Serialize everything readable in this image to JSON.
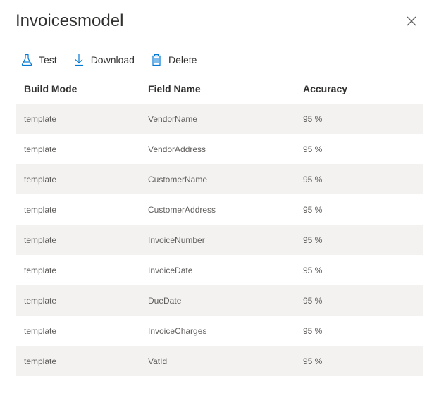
{
  "panel": {
    "title": "Invoicesmodel"
  },
  "toolbar": {
    "test_label": "Test",
    "download_label": "Download",
    "delete_label": "Delete"
  },
  "icons": {
    "test": "flask-icon",
    "download": "download-arrow-icon",
    "delete": "trash-icon",
    "close": "close-icon"
  },
  "colors": {
    "accent": "#0078d4",
    "row_alt": "#f3f2f1",
    "text": "#323130",
    "subtext": "#605e5c"
  },
  "table": {
    "headers": [
      "Build Mode",
      "Field Name",
      "Accuracy"
    ],
    "rows": [
      {
        "build_mode": "template",
        "field_name": "VendorName",
        "accuracy": "95 %"
      },
      {
        "build_mode": "template",
        "field_name": "VendorAddress",
        "accuracy": "95 %"
      },
      {
        "build_mode": "template",
        "field_name": "CustomerName",
        "accuracy": "95 %"
      },
      {
        "build_mode": "template",
        "field_name": "CustomerAddress",
        "accuracy": "95 %"
      },
      {
        "build_mode": "template",
        "field_name": "InvoiceNumber",
        "accuracy": "95 %"
      },
      {
        "build_mode": "template",
        "field_name": "InvoiceDate",
        "accuracy": "95 %"
      },
      {
        "build_mode": "template",
        "field_name": "DueDate",
        "accuracy": "95 %"
      },
      {
        "build_mode": "template",
        "field_name": "InvoiceCharges",
        "accuracy": "95 %"
      },
      {
        "build_mode": "template",
        "field_name": "VatId",
        "accuracy": "95 %"
      }
    ]
  }
}
